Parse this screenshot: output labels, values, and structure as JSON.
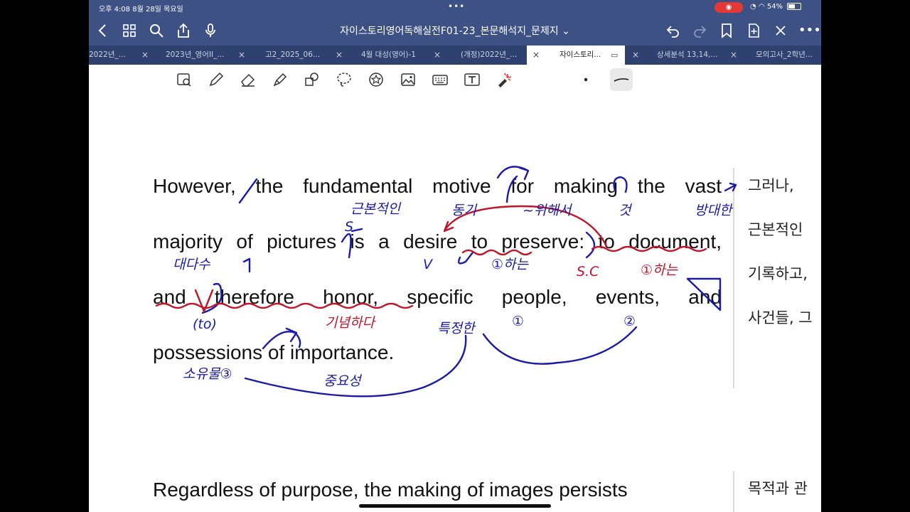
{
  "status": {
    "time": "오후 4:08  8월 28일 목요일",
    "battery": "54%",
    "dots": "•••"
  },
  "nav": {
    "title": "자이스토리영어독해실전F01-23_본문해석지_문제지",
    "icons": [
      "back-icon",
      "grid-icon",
      "search-icon",
      "share-icon",
      "mic-icon",
      "undo-icon",
      "redo-icon",
      "bookmark-icon",
      "add-page-icon",
      "close-icon",
      "more-icon"
    ]
  },
  "tabs": [
    {
      "label": "2022년_..."
    },
    {
      "label": "2023년_영어II_..."
    },
    {
      "label": "고2_2025_06..."
    },
    {
      "label": "4월 대성(영어)-1"
    },
    {
      "label": "(개정)2022년_..."
    },
    {
      "label": "자이스토리..."
    },
    {
      "label": "상세분석 13,14,..."
    },
    {
      "label": "모의고사_2학년..."
    }
  ],
  "toolbar": {
    "tools": [
      "lasso-zoom-icon",
      "pen-icon",
      "eraser-icon",
      "highlighter-icon",
      "shapes-icon",
      "lasso-icon",
      "sticker-icon",
      "image-icon",
      "keyboard-icon",
      "text-icon",
      "laser-pointer-icon"
    ]
  },
  "document": {
    "para1_lines": [
      "However, the fundamental motive for making the vast",
      "majority of pictures is a desire to preserve: to document,",
      "and therefore honor, specific people, events, and",
      "possessions of importance."
    ],
    "para2_lines": [
      "Regardless of purpose, the making of images persists"
    ],
    "translation1": [
      "그러나,",
      "근본적인",
      "기록하고,",
      "사건들, 그"
    ],
    "translation2": [
      "목적과 관"
    ]
  },
  "annotations": {
    "blue": [
      "근본적인",
      "동기",
      "~위해서",
      "것",
      "방대한",
      "대다수",
      "V",
      "①하는",
      "S",
      "V",
      "특정한",
      "①",
      "②",
      "소유물③",
      "중요성",
      "(to)"
    ],
    "red": [
      "기념하다",
      "①하는",
      "S.C"
    ],
    "colors": {
      "blue": "#1a1aa8",
      "red": "#c0162a"
    }
  }
}
